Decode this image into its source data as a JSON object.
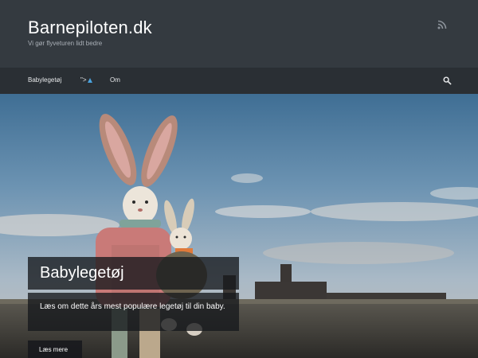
{
  "header": {
    "title": "Barnepiloten.dk",
    "tagline": "Vi gør flyveturen lidt bedre",
    "rss_icon": "rss-icon"
  },
  "nav": {
    "items": [
      {
        "label": "Babylegetøj"
      },
      {
        "label": "\">"
      },
      {
        "label": "Om"
      }
    ],
    "search_icon": "search-icon"
  },
  "hero": {
    "image": "plush bunnies sitting on a stone wall against a blue sky",
    "caption_title": "Babylegetøj",
    "caption_text": "Læs om dette års mest populære legetøj til din baby.",
    "read_more": "Læs mere"
  },
  "colors": {
    "header_bg": "#343a40",
    "nav_bg": "#2a2f34",
    "badge_accent": "#4aa3df"
  }
}
